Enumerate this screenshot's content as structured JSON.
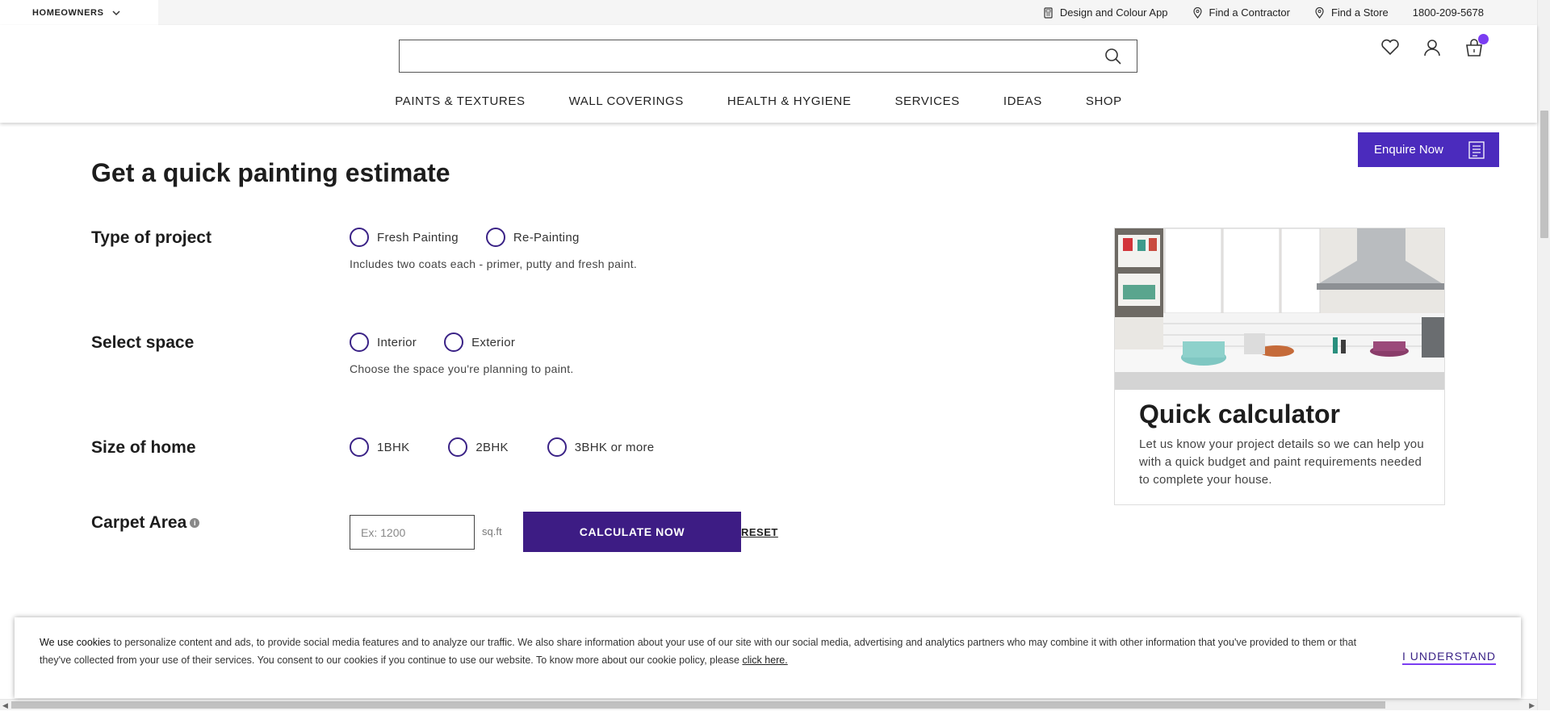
{
  "topbar": {
    "audience": "HOMEOWNERS",
    "links": [
      "Design and Colour App",
      "Find a Contractor",
      "Find a Store"
    ],
    "phone": "1800-209-5678"
  },
  "search": {
    "placeholder": ""
  },
  "nav": [
    "PAINTS & TEXTURES",
    "WALL COVERINGS",
    "HEALTH & HYGIENE",
    "SERVICES",
    "IDEAS",
    "SHOP"
  ],
  "enquire": {
    "label": "Enquire Now"
  },
  "page": {
    "title": "Get a quick painting estimate"
  },
  "form": {
    "project": {
      "label": "Type of project",
      "options": [
        "Fresh Painting",
        "Re-Painting"
      ],
      "hint": "Includes two coats each - primer, putty and fresh paint."
    },
    "space": {
      "label": "Select space",
      "options": [
        "Interior",
        "Exterior"
      ],
      "hint": "Choose the space you're planning to paint."
    },
    "size": {
      "label": "Size of home",
      "options": [
        "1BHK",
        "2BHK",
        "3BHK or more"
      ]
    },
    "carpet": {
      "label": "Carpet Area",
      "placeholder": "Ex: 1200",
      "unit": "sq.ft",
      "info_glyph": "i"
    },
    "calculate_label": "CALCULATE NOW",
    "reset_label": "RESET"
  },
  "card": {
    "title": "Quick calculator",
    "description": "Let us know your project details so we can help you with a quick budget and paint requirements needed to complete your house."
  },
  "cookie": {
    "lead": "We use cookies",
    "text": " to personalize content and ads, to provide social media features and to analyze our traffic. We also share information about your use of our site with our social media, advertising and analytics partners who may combine it with other information that you've provided to them or that they've collected from your use of their services. You consent to our cookies if you continue to use our website. To know more about our cookie policy, please ",
    "link": "click here.",
    "accept": "I UNDERSTAND"
  },
  "colors": {
    "accent": "#3d1c84",
    "enquire": "#4b2bbd",
    "badge": "#7b3df2"
  },
  "icons": [
    "chevron-down-icon",
    "phone-app-icon",
    "location-pin-icon",
    "search-icon",
    "heart-icon",
    "user-icon",
    "cart-icon",
    "document-icon",
    "info-icon"
  ]
}
